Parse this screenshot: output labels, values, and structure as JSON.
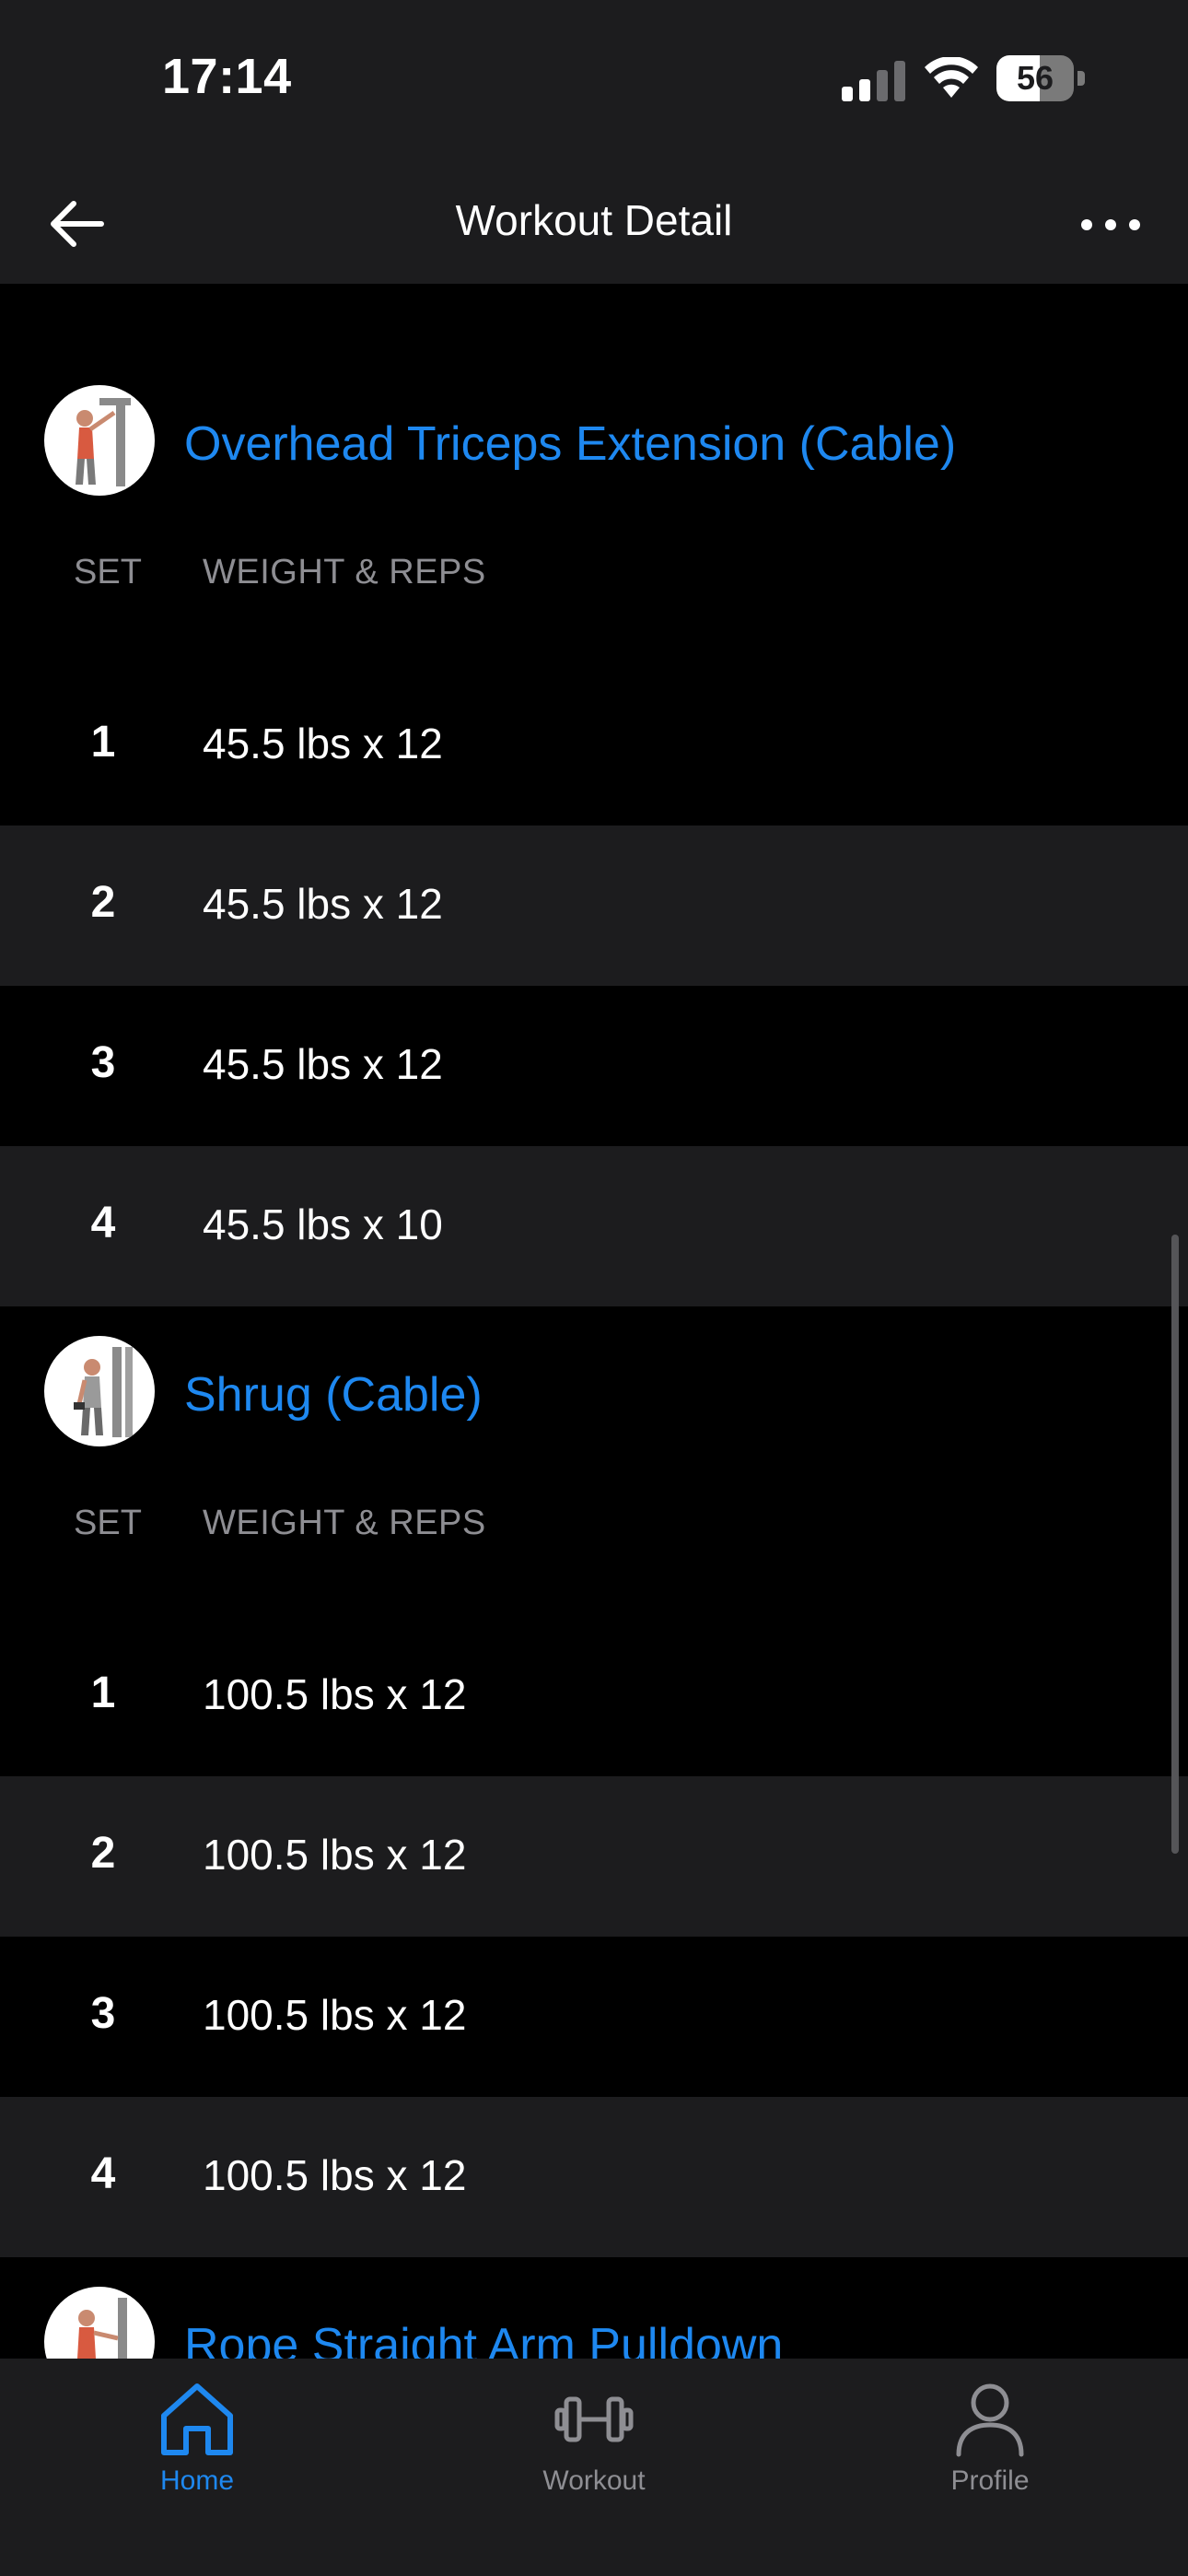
{
  "status_bar": {
    "time": "17:14",
    "battery_level": "56",
    "battery_fraction": 0.56
  },
  "nav": {
    "title": "Workout Detail",
    "back_icon": "arrow-left-icon",
    "more_icon": "ellipsis-icon"
  },
  "columns": {
    "set": "SET",
    "weight_reps": "WEIGHT & REPS"
  },
  "exercises": [
    {
      "name": "Overhead Triceps Extension (Cable)",
      "thumbnail_icon": "exercise-thumbnail-icon",
      "sets": [
        {
          "set": "1",
          "value": "45.5 lbs x 12"
        },
        {
          "set": "2",
          "value": "45.5 lbs x 12"
        },
        {
          "set": "3",
          "value": "45.5 lbs x 12"
        },
        {
          "set": "4",
          "value": "45.5 lbs x 10"
        }
      ]
    },
    {
      "name": "Shrug (Cable)",
      "thumbnail_icon": "exercise-thumbnail-icon",
      "sets": [
        {
          "set": "1",
          "value": "100.5 lbs x 12"
        },
        {
          "set": "2",
          "value": "100.5 lbs x 12"
        },
        {
          "set": "3",
          "value": "100.5 lbs x 12"
        },
        {
          "set": "4",
          "value": "100.5 lbs x 12"
        }
      ]
    },
    {
      "name": "Rope Straight Arm Pulldown",
      "thumbnail_icon": "exercise-thumbnail-icon",
      "sets": []
    }
  ],
  "tab_bar": {
    "tabs": [
      {
        "label": "Home",
        "icon": "home-icon",
        "active": true
      },
      {
        "label": "Workout",
        "icon": "dumbbell-icon",
        "active": false
      },
      {
        "label": "Profile",
        "icon": "person-icon",
        "active": false
      }
    ]
  },
  "colors": {
    "accent": "#1e88f0",
    "background": "#000000",
    "surface": "#1c1c1e",
    "muted_text": "#8e8e93"
  }
}
